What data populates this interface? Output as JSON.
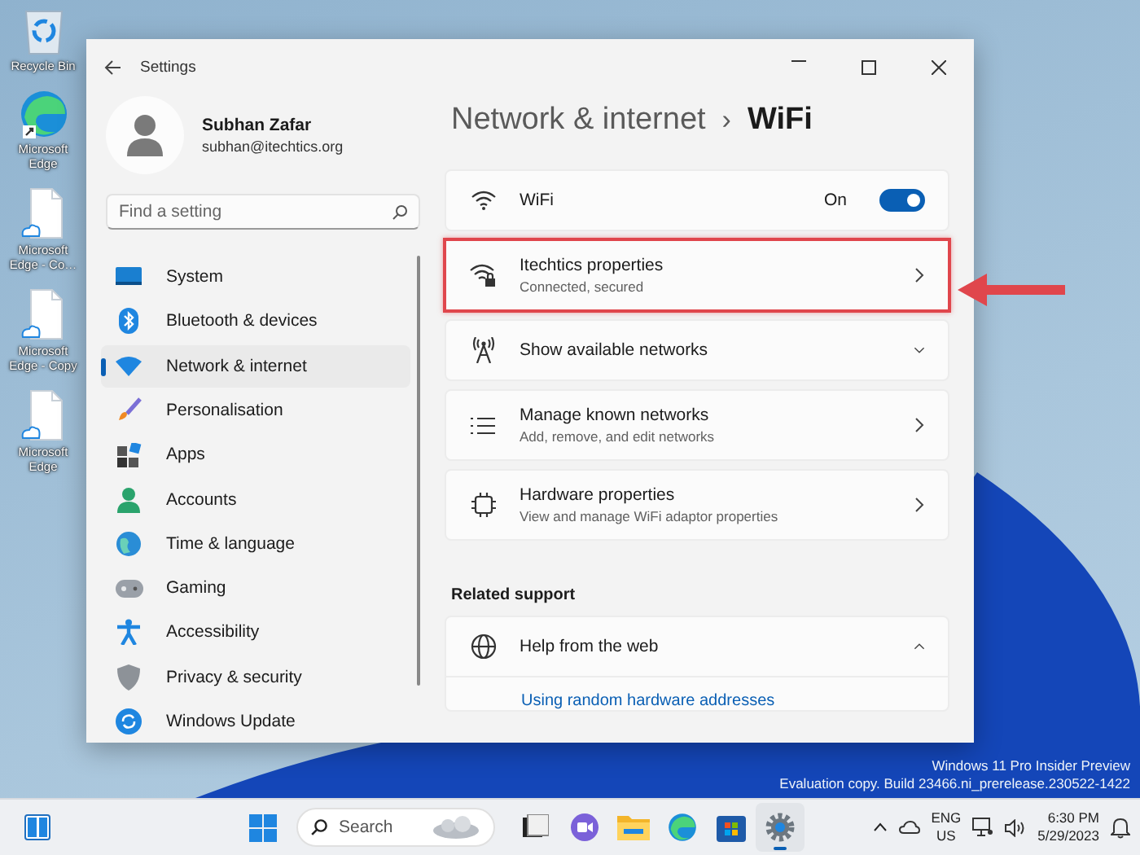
{
  "desktop_icons": [
    {
      "label": "Recycle Bin",
      "kind": "recycle"
    },
    {
      "label": "Microsoft Edge",
      "kind": "edge"
    },
    {
      "label": "Microsoft Edge - Co…",
      "kind": "file"
    },
    {
      "label": "Microsoft Edge - Copy",
      "kind": "file"
    },
    {
      "label": "Microsoft Edge",
      "kind": "file"
    }
  ],
  "window": {
    "title": "Settings"
  },
  "profile": {
    "name": "Subhan Zafar",
    "email": "subhan@itechtics.org"
  },
  "search": {
    "placeholder": "Find a setting"
  },
  "sidebar": {
    "items": [
      {
        "label": "System",
        "kind": "system",
        "selected": false
      },
      {
        "label": "Bluetooth & devices",
        "kind": "bluetooth",
        "selected": false
      },
      {
        "label": "Network & internet",
        "kind": "network",
        "selected": true
      },
      {
        "label": "Personalisation",
        "kind": "brush",
        "selected": false
      },
      {
        "label": "Apps",
        "kind": "apps",
        "selected": false
      },
      {
        "label": "Accounts",
        "kind": "person",
        "selected": false
      },
      {
        "label": "Time & language",
        "kind": "globe",
        "selected": false
      },
      {
        "label": "Gaming",
        "kind": "gamepad",
        "selected": false
      },
      {
        "label": "Accessibility",
        "kind": "accessibility",
        "selected": false
      },
      {
        "label": "Privacy & security",
        "kind": "shield",
        "selected": false
      },
      {
        "label": "Windows Update",
        "kind": "update",
        "selected": false
      }
    ]
  },
  "breadcrumb": {
    "parent": "Network & internet",
    "separator": "›",
    "current": "WiFi"
  },
  "cards": [
    {
      "kind": "toggle",
      "title": "WiFi",
      "state_label": "On",
      "on": true
    },
    {
      "kind": "link",
      "title": "Itechtics properties",
      "subtitle": "Connected, secured",
      "highlighted": true
    },
    {
      "kind": "expander",
      "title": "Show available networks",
      "expanded": false
    },
    {
      "kind": "link",
      "title": "Manage known networks",
      "subtitle": "Add, remove, and edit networks",
      "highlighted": false
    },
    {
      "kind": "link",
      "title": "Hardware properties",
      "subtitle": "View and manage WiFi adaptor properties",
      "highlighted": false
    }
  ],
  "related_support": {
    "heading": "Related support",
    "cards": [
      {
        "kind": "expander",
        "title": "Help from the web",
        "expanded": true,
        "links": [
          "Using random hardware addresses"
        ]
      }
    ]
  },
  "desktop_notice": {
    "lines": [
      "Windows 11 Pro Insider Preview",
      "Evaluation copy. Build 23466.ni_prerelease.230522-1422"
    ]
  },
  "taskbar": {
    "search": {
      "placeholder": "Search"
    },
    "apps": [
      {
        "kind": "taskview",
        "selected": false
      },
      {
        "kind": "chat",
        "selected": false
      },
      {
        "kind": "folder",
        "selected": false
      },
      {
        "kind": "edge",
        "selected": false
      },
      {
        "kind": "store",
        "selected": false
      },
      {
        "kind": "settings",
        "selected": true
      }
    ],
    "language": "ENG",
    "region": "US",
    "time": "6:30 PM",
    "date": "5/29/2023"
  }
}
